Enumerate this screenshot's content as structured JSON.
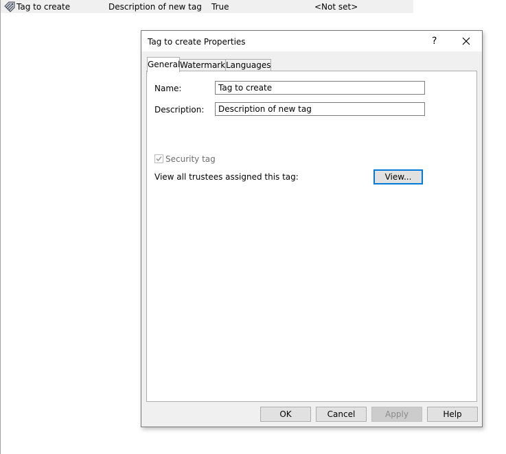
{
  "list_row": {
    "name": "Tag to create",
    "description": "Description of new tag",
    "security": "True",
    "watermark": "<Not set>",
    "icon": "tag-icon"
  },
  "dialog": {
    "title": "Tag to create Properties",
    "help_label": "?",
    "close_icon": "close-icon",
    "tabs": [
      {
        "label": "General"
      },
      {
        "label": "Watermark"
      },
      {
        "label": "Languages"
      }
    ],
    "general": {
      "name_label": "Name:",
      "name_value": "Tag to create",
      "description_label": "Description:",
      "description_value": "Description of new tag",
      "security_tag_label": "Security tag",
      "security_tag_checked": true,
      "view_trustees_label": "View all trustees assigned this tag:",
      "view_button": "View..."
    },
    "buttons": {
      "ok": "OK",
      "cancel": "Cancel",
      "apply": "Apply",
      "help": "Help"
    }
  },
  "colors": {
    "dialog_bg": "#f0f0f0",
    "focus_border": "#0078d7"
  }
}
